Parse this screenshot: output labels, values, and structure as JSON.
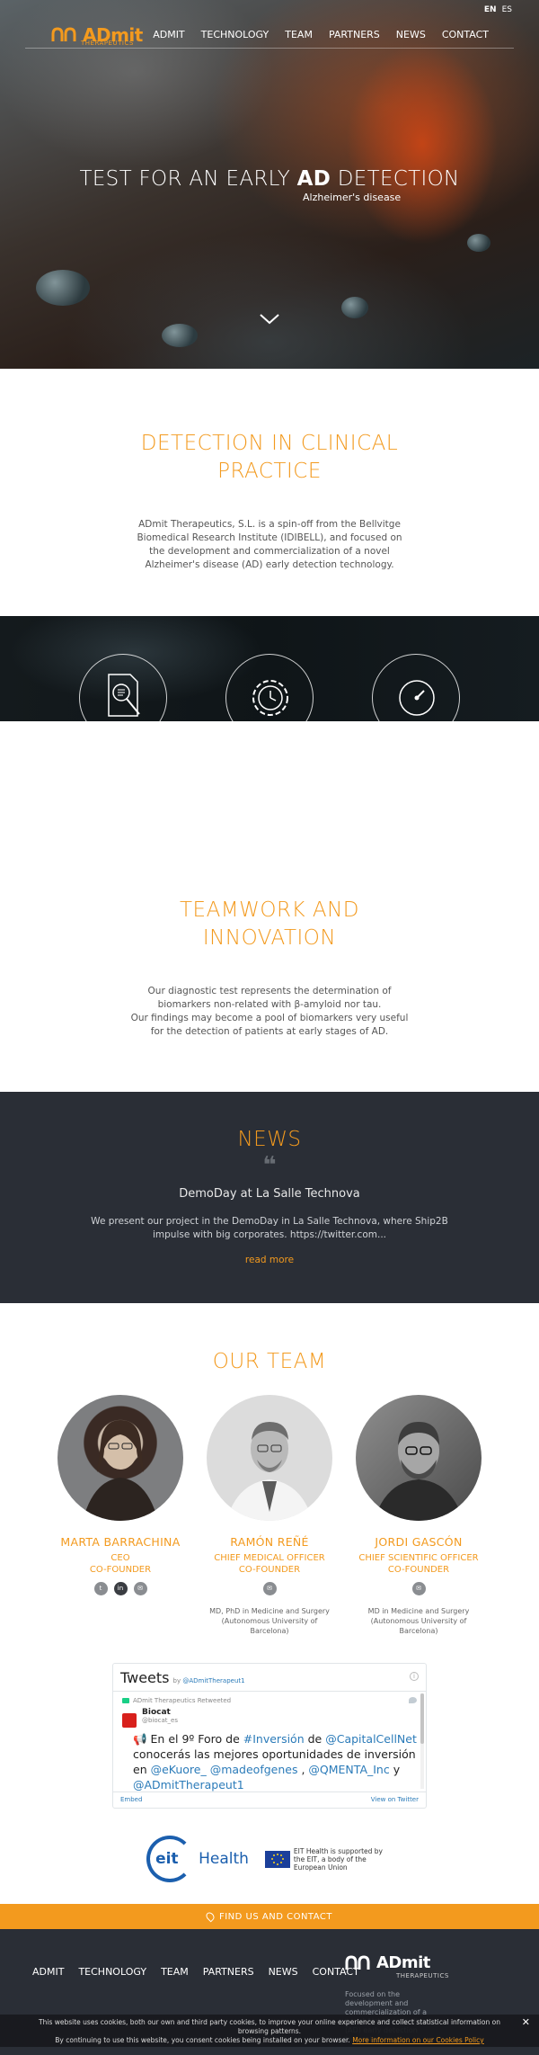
{
  "language": {
    "en": "EN",
    "es": "ES"
  },
  "brand": {
    "name": "ADmit",
    "sub": "THERAPEUTICS"
  },
  "nav": [
    "ADMIT",
    "TECHNOLOGY",
    "TEAM",
    "PARTNERS",
    "NEWS",
    "CONTACT"
  ],
  "hero": {
    "title_pre": "TEST FOR AN EARLY ",
    "title_bold": "AD",
    "title_post": " DETECTION",
    "subtitle": "Alzheimer's disease"
  },
  "detection": {
    "title_line1": "DETECTION IN CLINICAL",
    "title_line2": "PRACTICE",
    "text": "ADmit Therapeutics, S.L. is a spin-off from the Bellvitge Biomedical Research Institute (IDIBELL), and focused on the development and commercialization of a novel Alzheimer's disease (AD) early detection technology."
  },
  "icons": [
    "document-search-icon",
    "gear-clock-icon",
    "speedometer-icon"
  ],
  "teamwork": {
    "title_line1": "TEAMWORK AND",
    "title_line2": "INNOVATION",
    "text1": "Our diagnostic test represents the determination of biomarkers non-related with β-amyloid nor tau.",
    "text2": "Our findings may become a pool of biomarkers very useful for the detection of patients at early stages of AD."
  },
  "news": {
    "title": "NEWS",
    "quote": "❝",
    "headline": "DemoDay at La Salle Technova",
    "text": "We present our project in the DemoDay in La Salle Technova, where Ship2B impulse with big corporates. https://twitter.com...",
    "read_more": "read more"
  },
  "team": {
    "title": "OUR TEAM",
    "members": [
      {
        "name": "MARTA BARRACHINA",
        "role1": "CEO",
        "role2": "CO-FOUNDER",
        "degree1": "",
        "degree2": ""
      },
      {
        "name": "RAMÓN REÑÉ",
        "role1": "CHIEF MEDICAL OFFICER",
        "role2": "CO-FOUNDER",
        "degree1": "MD, PhD in Medicine and Surgery",
        "degree2": "(Autonomous University of Barcelona)"
      },
      {
        "name": "JORDI GASCÓN",
        "role1": "CHIEF SCIENTIFIC OFFICER",
        "role2": "CO-FOUNDER",
        "degree1": "MD in Medicine and Surgery",
        "degree2": "(Autonomous University of Barcelona)"
      }
    ]
  },
  "tweets": {
    "title": "Tweets",
    "by": "by",
    "handle": "@ADmitTherapeut1",
    "retweeted": "ADmit Therapeutics Retweeted",
    "user_name": "Biocat",
    "user_handle": "@biocat_es",
    "text_1": "📢 En el 9º Foro de ",
    "text_link1": "#Inversión",
    "text_2": " de ",
    "text_link2": "@CapitalCellNet",
    "text_3": " conocerás las mejores oportunidades de inversión en ",
    "text_link3": "@eKuore_",
    "text_4": " ",
    "text_link4": "@madeofgenes",
    "text_5": " , ",
    "text_link5": "@QMENTA_Inc",
    "text_6": " y ",
    "text_link6": "@ADmitTherapeut1",
    "embed": "Embed",
    "view": "View on Twitter"
  },
  "partners": {
    "eit": "eit",
    "health": "Health",
    "eu_text": "EIT Health is supported by the EIT, a body of the European Union"
  },
  "findus": "FIND US AND CONTACT",
  "footer": {
    "text": "Focused on the development and commercialization of a novel Alzheimer's disease (AD) early detection technology."
  },
  "cookie": {
    "text1": "This website uses cookies, both our own and third party cookies, to improve your online experience and collect statistical information on browsing patterns.",
    "text2": "By continuing to use this website, you consent cookies being installed on your browser.",
    "link": "More information on our Cookies Policy",
    "close": "✕"
  },
  "colors": {
    "accent": "#f39a1e",
    "dark": "#2a2e36"
  }
}
